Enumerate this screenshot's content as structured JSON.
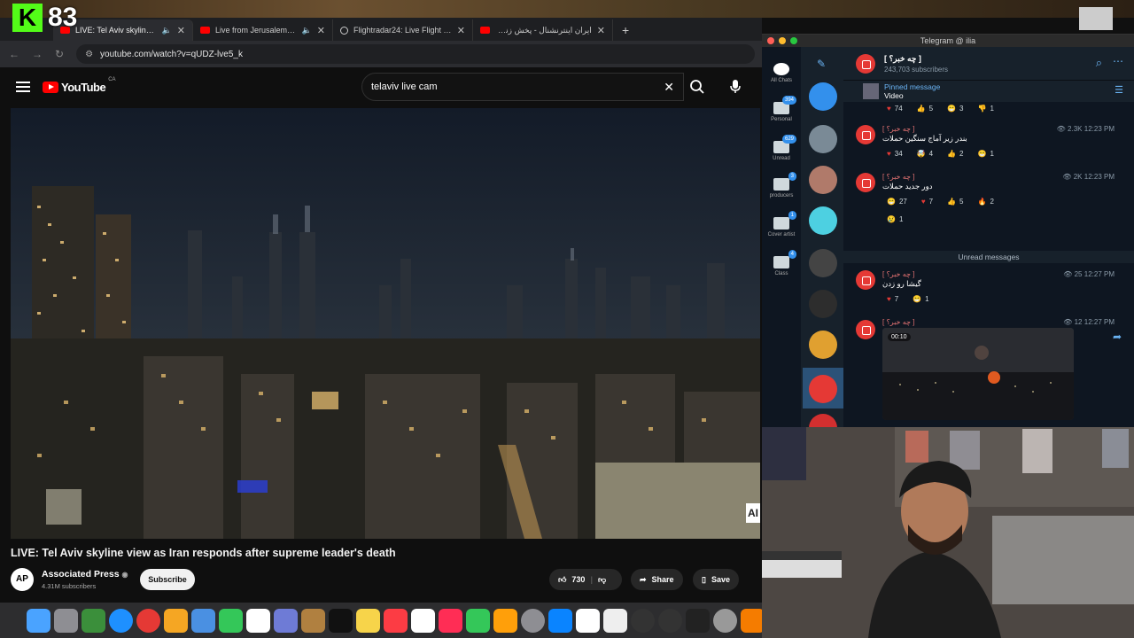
{
  "overlay": {
    "kick_letter": "K",
    "viewer_count": "83"
  },
  "browser": {
    "tabs": [
      {
        "title": "LIVE: Tel Aviv skyline view",
        "favicon": "youtube-icon",
        "active": true
      },
      {
        "title": "Live from Jerusalem as al",
        "favicon": "youtube-icon",
        "active": false
      },
      {
        "title": "Flightradar24: Live Flight Tra",
        "favicon": "flightradar-icon",
        "active": false
      },
      {
        "title": "ایران اینترنشنال - پخش زنده - ube",
        "favicon": "youtube-icon",
        "active": false
      }
    ],
    "url": "youtube.com/watch?v=qUDZ-lve5_k"
  },
  "youtube": {
    "logo_text": "YouTube",
    "country": "CA",
    "search_value": "telaviv live cam",
    "video_title": "LIVE: Tel Aviv skyline view as Iran responds after supreme leader's death",
    "channel": {
      "name": "Associated Press",
      "subscribers": "4.31M subscribers",
      "avatar": "AP"
    },
    "subscribe_label": "Subscribe",
    "likes": "730",
    "share_label": "Share",
    "save_label": "Save",
    "video_corner_badge": "AI"
  },
  "telegram": {
    "window_title": "Telegram @ ilia",
    "folders": [
      {
        "label": "All Chats",
        "badge": ""
      },
      {
        "label": "Personal",
        "badge": "394"
      },
      {
        "label": "Unread",
        "badge": "629"
      },
      {
        "label": "producers",
        "badge": "3"
      },
      {
        "label": "Cover artist",
        "badge": "1"
      },
      {
        "label": "Class",
        "badge": "4"
      }
    ],
    "channel_name": "[ چه خبر؟ ]",
    "channel_subs": "243,703 subscribers",
    "pinned": {
      "label": "Pinned message",
      "text": "Video"
    },
    "top_reactions": [
      {
        "e": "♥",
        "n": "74"
      },
      {
        "e": "👍",
        "n": "5"
      },
      {
        "e": "😁",
        "n": "3"
      },
      {
        "e": "👎",
        "n": "1"
      }
    ],
    "messages": [
      {
        "sender": "[ چه خبر؟ ]",
        "text": "بندر زیر آماج سنگین حملات",
        "views": "2.3K",
        "time": "12:23 PM",
        "reactions": [
          {
            "e": "♥",
            "n": "34"
          },
          {
            "e": "🤯",
            "n": "4"
          },
          {
            "e": "👍",
            "n": "2"
          },
          {
            "e": "😁",
            "n": "1"
          }
        ]
      },
      {
        "sender": "[ چه خبر؟ ]",
        "text": "دور جدید حملات",
        "views": "2K",
        "time": "12:23 PM",
        "reactions": [
          {
            "e": "😁",
            "n": "27"
          },
          {
            "e": "♥",
            "n": "7"
          },
          {
            "e": "👍",
            "n": "5"
          },
          {
            "e": "🔥",
            "n": "2"
          },
          {
            "e": "😢",
            "n": "1"
          }
        ]
      },
      {
        "sender": "[ چه خبر؟ ]",
        "text": "گیشا رو زدن",
        "views": "25",
        "time": "12:27 PM",
        "reactions": [
          {
            "e": "♥",
            "n": "7"
          },
          {
            "e": "😁",
            "n": "1"
          }
        ]
      },
      {
        "sender": "[ چه خبر؟ ]",
        "text": "",
        "views": "12",
        "time": "12:27 PM",
        "reactions": []
      }
    ],
    "unread_label": "Unread messages",
    "media_duration": "00:10"
  }
}
